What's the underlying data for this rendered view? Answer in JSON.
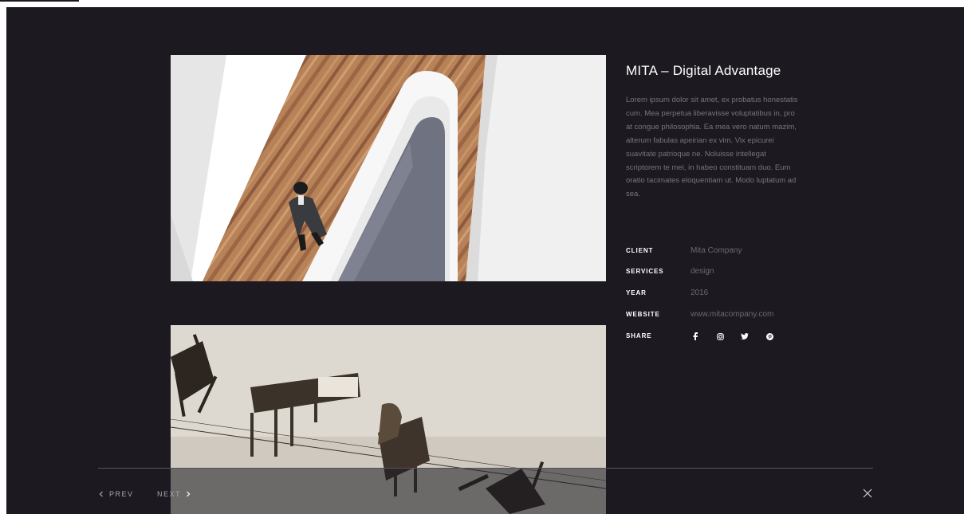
{
  "project": {
    "title": "MITA – Digital Advantage",
    "description": "Lorem ipsum dolor sit amet, ex probatus honestatis cum. Mea perpetua liberavisse voluptatibus in, pro at congue philosophia. Ea mea vero natum mazim, alterum fabulas apeirian ex vim. Vix epicurei suavitate patrioque ne. Noluisse intellegat scriptorem te mei, in habeo constituam duo. Eum oratio tacimates eloquentiam ut. Modo luptatum ad sea."
  },
  "meta": {
    "client_label": "CLIENT",
    "client_value": "Mita Company",
    "services_label": "SERVICES",
    "services_value": "design",
    "year_label": "YEAR",
    "year_value": "2016",
    "website_label": "WEBSITE",
    "website_value": "www.mitacompany.com",
    "share_label": "SHARE"
  },
  "share_icons": [
    "facebook-icon",
    "instagram-icon",
    "twitter-icon",
    "pinterest-icon"
  ],
  "nav": {
    "prev_label": "PREV",
    "next_label": "NEXT"
  },
  "colors": {
    "background": "#1c1a20",
    "title": "#ffffff",
    "body_text": "#77747b",
    "meta_value": "#6b6870",
    "divider": "#57545a"
  }
}
